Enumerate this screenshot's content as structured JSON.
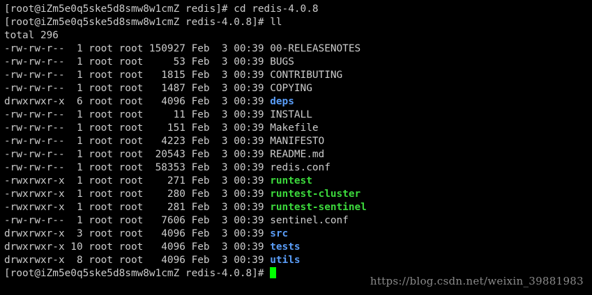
{
  "terminal": {
    "lines": [
      {
        "kind": "prompt",
        "text": "[root@iZm5e0q5ske5d8smw8w1cmZ redis]# cd redis-4.0.8"
      },
      {
        "kind": "prompt",
        "text": "[root@iZm5e0q5ske5d8smw8w1cmZ redis-4.0.8]# ll"
      },
      {
        "kind": "text",
        "text": "total 296"
      },
      {
        "kind": "entry",
        "prefix": "-rw-rw-r--  1 root root 150927 Feb  3 00:39 ",
        "name": "00-RELEASENOTES",
        "type": "file"
      },
      {
        "kind": "entry",
        "prefix": "-rw-rw-r--  1 root root     53 Feb  3 00:39 ",
        "name": "BUGS",
        "type": "file"
      },
      {
        "kind": "entry",
        "prefix": "-rw-rw-r--  1 root root   1815 Feb  3 00:39 ",
        "name": "CONTRIBUTING",
        "type": "file"
      },
      {
        "kind": "entry",
        "prefix": "-rw-rw-r--  1 root root   1487 Feb  3 00:39 ",
        "name": "COPYING",
        "type": "file"
      },
      {
        "kind": "entry",
        "prefix": "drwxrwxr-x  6 root root   4096 Feb  3 00:39 ",
        "name": "deps",
        "type": "dir"
      },
      {
        "kind": "entry",
        "prefix": "-rw-rw-r--  1 root root     11 Feb  3 00:39 ",
        "name": "INSTALL",
        "type": "file"
      },
      {
        "kind": "entry",
        "prefix": "-rw-rw-r--  1 root root    151 Feb  3 00:39 ",
        "name": "Makefile",
        "type": "file"
      },
      {
        "kind": "entry",
        "prefix": "-rw-rw-r--  1 root root   4223 Feb  3 00:39 ",
        "name": "MANIFESTO",
        "type": "file"
      },
      {
        "kind": "entry",
        "prefix": "-rw-rw-r--  1 root root  20543 Feb  3 00:39 ",
        "name": "README.md",
        "type": "file"
      },
      {
        "kind": "entry",
        "prefix": "-rw-rw-r--  1 root root  58353 Feb  3 00:39 ",
        "name": "redis.conf",
        "type": "file"
      },
      {
        "kind": "entry",
        "prefix": "-rwxrwxr-x  1 root root    271 Feb  3 00:39 ",
        "name": "runtest",
        "type": "exec"
      },
      {
        "kind": "entry",
        "prefix": "-rwxrwxr-x  1 root root    280 Feb  3 00:39 ",
        "name": "runtest-cluster",
        "type": "exec"
      },
      {
        "kind": "entry",
        "prefix": "-rwxrwxr-x  1 root root    281 Feb  3 00:39 ",
        "name": "runtest-sentinel",
        "type": "exec"
      },
      {
        "kind": "entry",
        "prefix": "-rw-rw-r--  1 root root   7606 Feb  3 00:39 ",
        "name": "sentinel.conf",
        "type": "file"
      },
      {
        "kind": "entry",
        "prefix": "drwxrwxr-x  3 root root   4096 Feb  3 00:39 ",
        "name": "src",
        "type": "dir"
      },
      {
        "kind": "entry",
        "prefix": "drwxrwxr-x 10 root root   4096 Feb  3 00:39 ",
        "name": "tests",
        "type": "dir"
      },
      {
        "kind": "entry",
        "prefix": "drwxrwxr-x  8 root root   4096 Feb  3 00:39 ",
        "name": "utils",
        "type": "dir"
      },
      {
        "kind": "current",
        "text": "[root@iZm5e0q5ske5d8smw8w1cmZ redis-4.0.8]# "
      }
    ],
    "watermark": "https://blog.csdn.net/weixin_39881983"
  },
  "colors": {
    "background": "#000000",
    "text": "#cccccc",
    "directory": "#5a9df7",
    "executable": "#3cd93c",
    "cursor": "#00ff00"
  }
}
